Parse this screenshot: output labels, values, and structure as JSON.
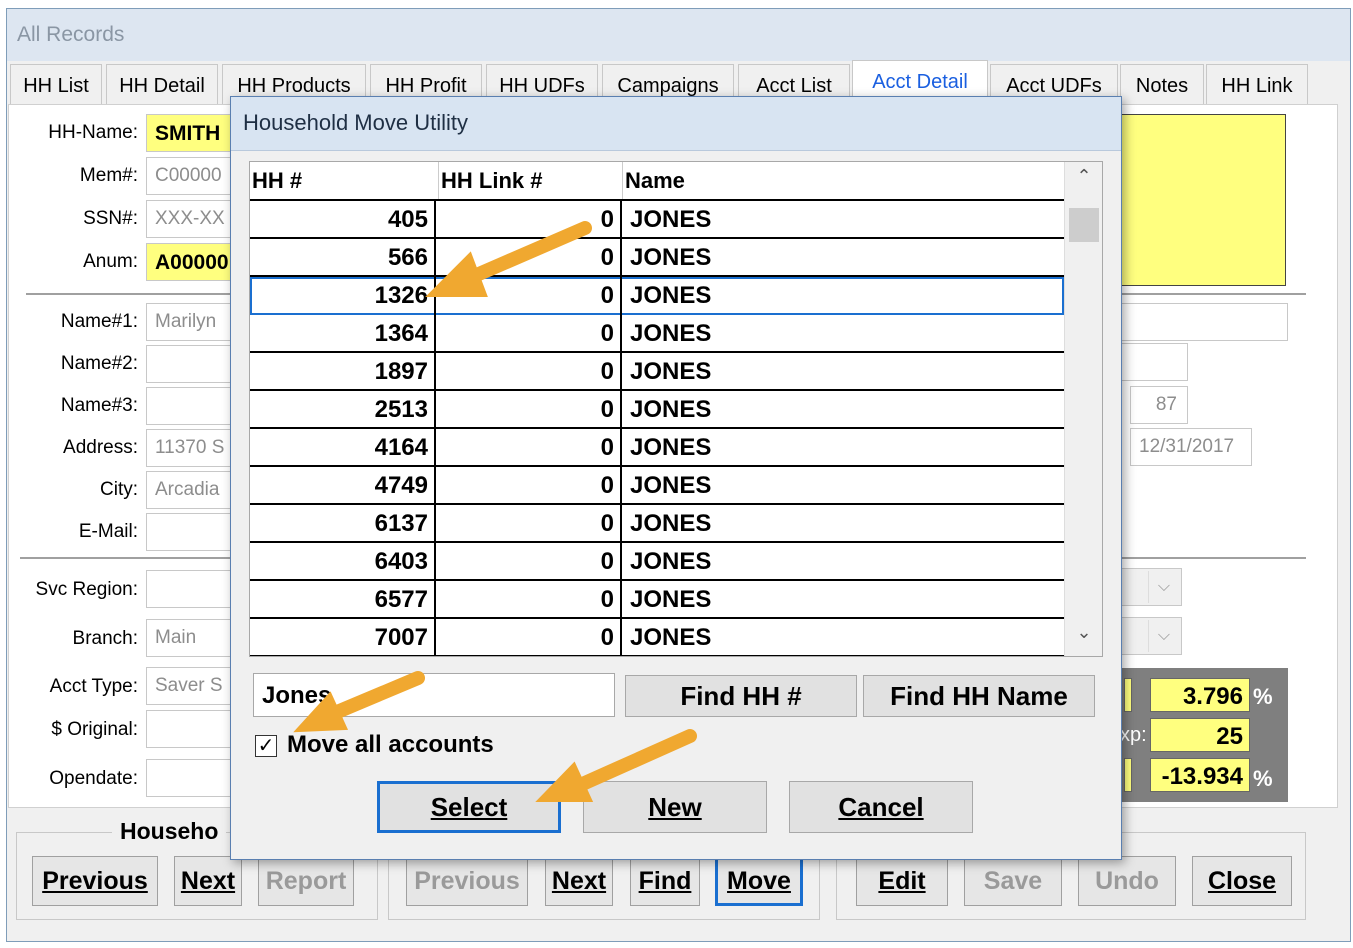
{
  "window": {
    "title": "All Records",
    "tabs": [
      {
        "label": "HH List",
        "active": false
      },
      {
        "label": "HH Detail",
        "active": false
      },
      {
        "label": "HH Products",
        "active": false
      },
      {
        "label": "HH Profit",
        "active": false
      },
      {
        "label": "HH UDFs",
        "active": false
      },
      {
        "label": "Campaigns",
        "active": false
      },
      {
        "label": "Acct List",
        "active": false
      },
      {
        "label": "Acct Detail",
        "active": true
      },
      {
        "label": "Acct UDFs",
        "active": false
      },
      {
        "label": "Notes",
        "active": false
      },
      {
        "label": "HH Link",
        "active": false
      }
    ]
  },
  "form": {
    "hh_name_label": "HH-Name:",
    "hh_name_value": "SMITH",
    "mem_label": "Mem#:",
    "mem_value": "C00000",
    "ssn_label": "SSN#:",
    "ssn_value": "XXX-XX",
    "anum_label": "Anum:",
    "anum_value": "A00000",
    "name1_label": "Name#1:",
    "name1_value": "Marilyn",
    "name2_label": "Name#2:",
    "name2_value": "",
    "name3_label": "Name#3:",
    "name3_value": "",
    "address_label": "Address:",
    "address_value": "11370 S",
    "city_label": "City:",
    "city_value": "Arcadia",
    "email_label": "E-Mail:",
    "email_value": "",
    "svc_region_label": "Svc Region:",
    "svc_region_value": "",
    "branch_label": "Branch:",
    "branch_value": "Main",
    "acct_type_label": "Acct Type:",
    "acct_type_value": "Saver S",
    "original_label": "$ Original:",
    "original_value": "",
    "opendate_label": "Opendate:",
    "opendate_value": "",
    "right_value_1": "87",
    "right_date": "12/31/2017",
    "rate_value": "3.796",
    "rate_unit": "%",
    "exp_label": "xp:",
    "exp_value": "25",
    "change_value": "-13.934",
    "change_unit": "%"
  },
  "bottom": {
    "household_group_label": "Househo",
    "previous_1": "Previous",
    "next_1": "Next",
    "report": "Report",
    "previous_2": "Previous",
    "next_2": "Next",
    "find": "Find",
    "move": "Move",
    "edit": "Edit",
    "save": "Save",
    "undo": "Undo",
    "close": "Close"
  },
  "dialog": {
    "title": "Household Move Utility",
    "columns": [
      "HH #",
      "HH Link #",
      "Name"
    ],
    "rows": [
      {
        "hh": "405",
        "link": "0",
        "name": "JONES"
      },
      {
        "hh": "566",
        "link": "0",
        "name": "JONES"
      },
      {
        "hh": "1326",
        "link": "0",
        "name": "JONES"
      },
      {
        "hh": "1364",
        "link": "0",
        "name": "JONES"
      },
      {
        "hh": "1897",
        "link": "0",
        "name": "JONES"
      },
      {
        "hh": "2513",
        "link": "0",
        "name": "JONES"
      },
      {
        "hh": "4164",
        "link": "0",
        "name": "JONES"
      },
      {
        "hh": "4749",
        "link": "0",
        "name": "JONES"
      },
      {
        "hh": "6137",
        "link": "0",
        "name": "JONES"
      },
      {
        "hh": "6403",
        "link": "0",
        "name": "JONES"
      },
      {
        "hh": "6577",
        "link": "0",
        "name": "JONES"
      },
      {
        "hh": "7007",
        "link": "0",
        "name": "JONES"
      }
    ],
    "search_value": "Jones",
    "find_hh_label": "Find HH #",
    "find_name_label": "Find HH Name",
    "move_all_label": "Move all accounts",
    "move_all_checked": true,
    "select_label": "Select",
    "new_label": "New",
    "cancel_label": "Cancel"
  },
  "colors": {
    "highlight_yellow": "#ffff7f",
    "annotation_arrow": "#f0a830",
    "focus_blue": "#1a6fd0",
    "active_tab": "#1a5fe0"
  }
}
